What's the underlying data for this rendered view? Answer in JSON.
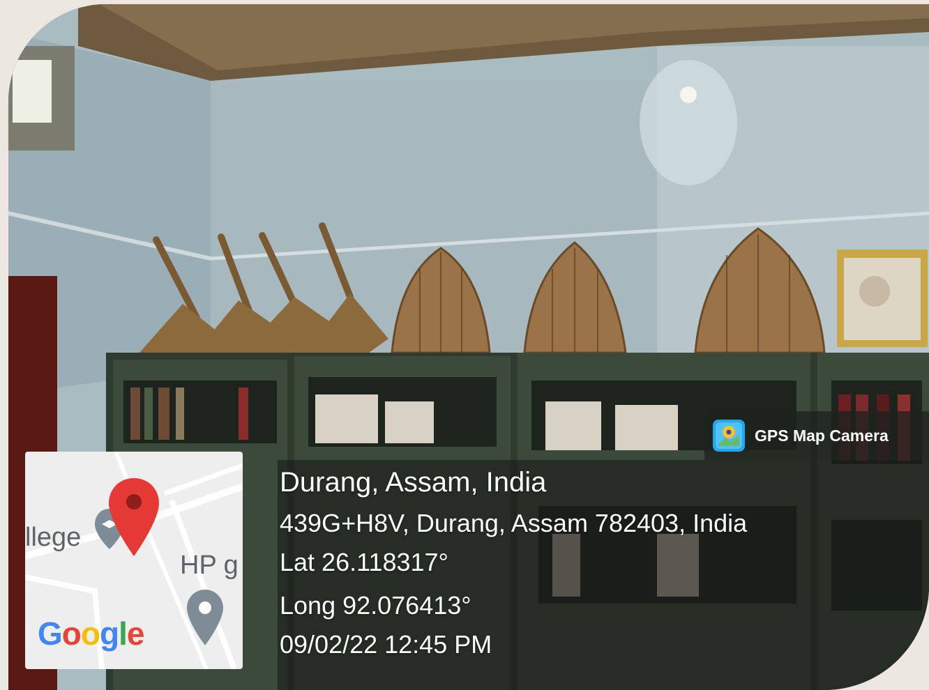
{
  "badge": {
    "icon": "gps-map-camera-logo-icon",
    "title": "GPS Map Camera"
  },
  "location": {
    "place": "Durang, Assam, India",
    "address": "439G+H8V, Durang, Assam 782403, India",
    "lat": "Lat 26.118317°",
    "long": "Long 92.076413°",
    "datetime": "09/02/22 12:45 PM"
  },
  "map": {
    "label_college": "llege",
    "label_hp": "HP g",
    "brand": [
      "G",
      "o",
      "o",
      "g",
      "l",
      "e"
    ],
    "colors": {
      "pin": "#e53935",
      "poi": "#7e8c96",
      "map_bg": "#eeeeee"
    },
    "icons": [
      "map-pin-icon",
      "college-poi-icon",
      "location-poi-icon"
    ]
  },
  "photo": {
    "description_tags": [
      "room",
      "bamboo baskets",
      "bookshelves"
    ]
  }
}
